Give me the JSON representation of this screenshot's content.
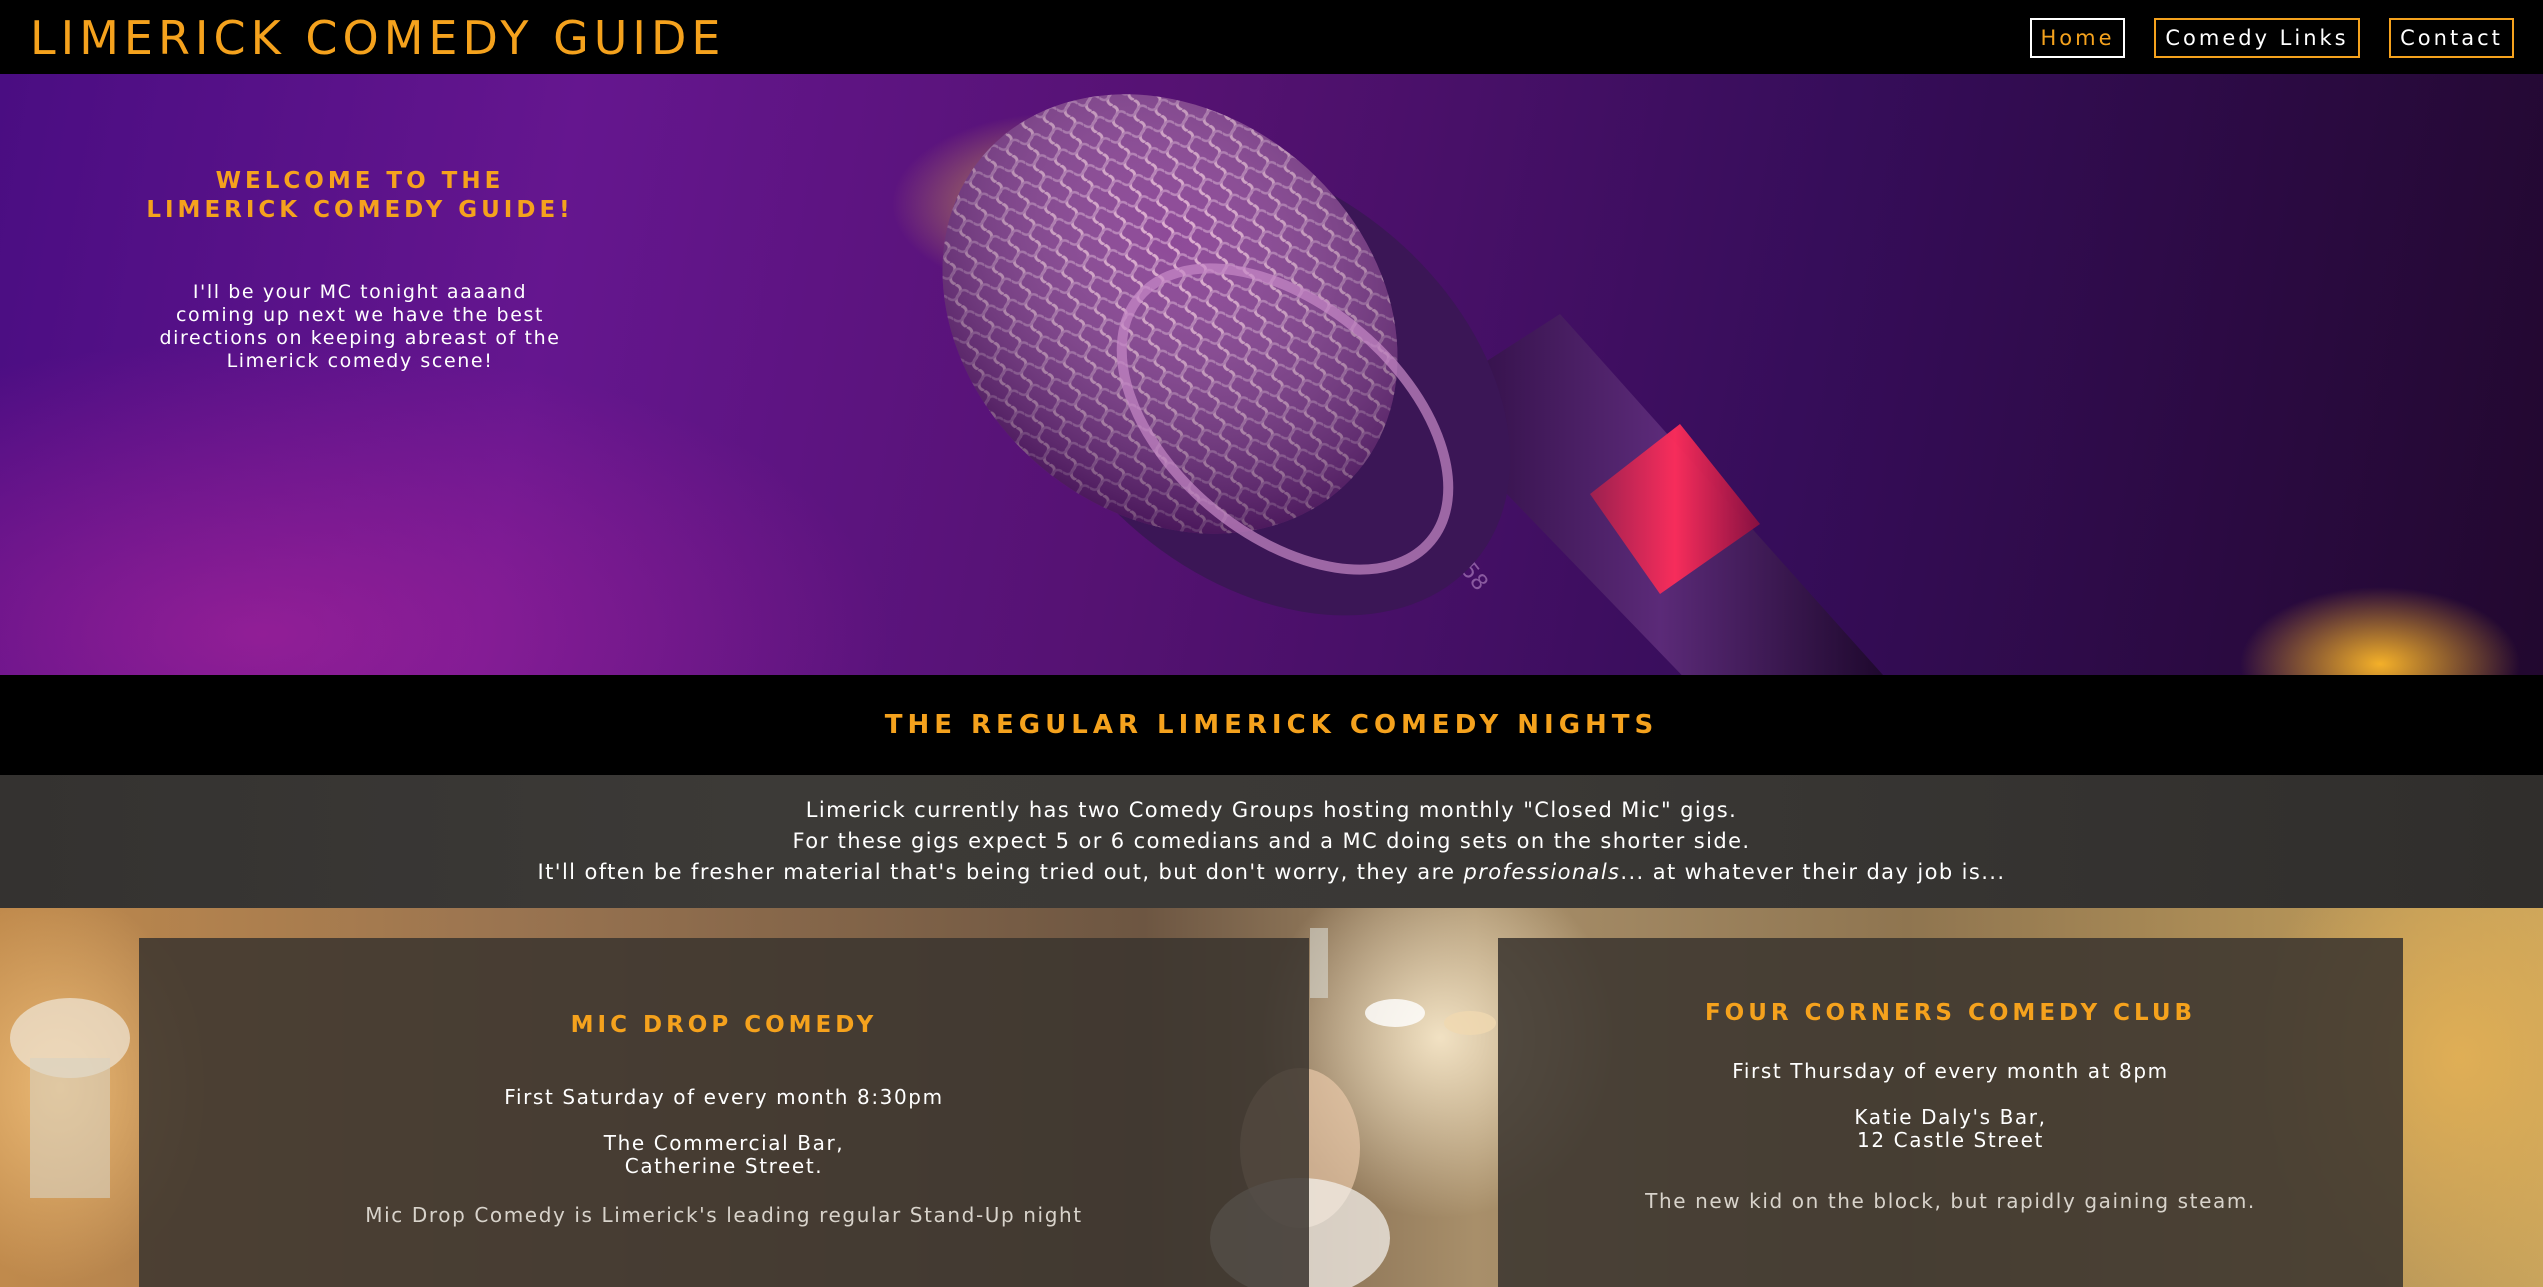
{
  "header": {
    "brand": "LIMERICK COMEDY GUIDE",
    "nav": [
      {
        "label": "Home",
        "active": true
      },
      {
        "label": "Comedy Links",
        "active": false
      },
      {
        "label": "Contact",
        "active": false
      }
    ]
  },
  "hero": {
    "title": "WELCOME TO THE\nLIMERICK COMEDY GUIDE!",
    "text": "I'll be your MC tonight aaaand coming up next we have the best directions on keeping abreast of the Limerick comedy scene!",
    "microphone_label": "SM58"
  },
  "section": {
    "title": "THE REGULAR LIMERICK COMEDY NIGHTS"
  },
  "intro": {
    "line1": "Limerick currently has two Comedy Groups hosting monthly \"Closed Mic\" gigs.",
    "line2": "For these gigs expect 5 or 6 comedians and a MC doing sets on the shorter side.",
    "line3_start": "It'll often be fresher material that's being tried out, but don't worry, they are ",
    "line3_emphasis": "professionals",
    "line3_end": "... at whatever their day job is..."
  },
  "gigs": [
    {
      "title": "MIC DROP COMEDY",
      "schedule": "First Saturday of every month 8:30pm",
      "venue_line1": "The Commercial Bar,",
      "venue_line2": "Catherine Street.",
      "description": "Mic Drop Comedy is Limerick's leading regular Stand-Up night"
    },
    {
      "title": "FOUR CORNERS COMEDY CLUB",
      "schedule": "First Thursday of every month at 8pm",
      "venue_line1": "Katie Daly's Bar,",
      "venue_line2": "12 Castle Street",
      "description": "The new kid on the block, but rapidly gaining steam."
    }
  ],
  "colors": {
    "accent": "#f5a21d",
    "header_bg": "#000000",
    "hero_purple": "#5a1488",
    "card_bg": "#3a342e"
  }
}
